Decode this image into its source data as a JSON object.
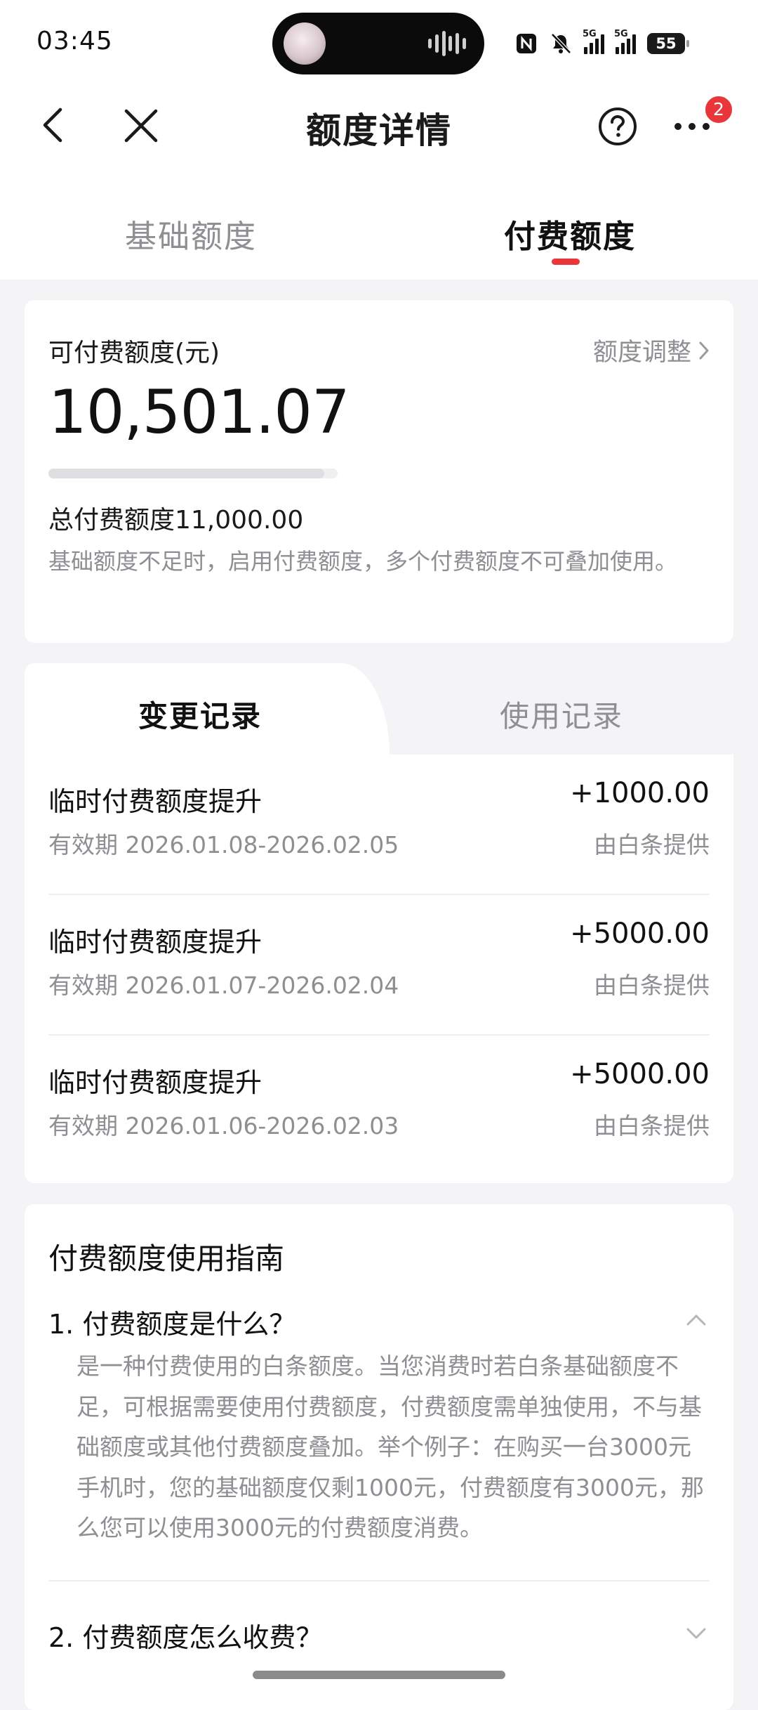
{
  "status": {
    "time": "03:45",
    "signal1_label": "5G",
    "signal2_label": "5G",
    "battery": "55"
  },
  "header": {
    "title": "额度详情",
    "badge_count": "2"
  },
  "tabs": {
    "basic": "基础额度",
    "paid": "付费额度"
  },
  "summary": {
    "available_label": "可付费额度(元)",
    "adjust_label": "额度调整",
    "available_amount": "10,501.07",
    "usage_fraction": 0.955,
    "total_label": "总付费额度11,000.00",
    "note": "基础额度不足时，启用付费额度，多个付费额度不可叠加使用。"
  },
  "records": {
    "tab_changes": "变更记录",
    "tab_usage": "使用记录",
    "items": [
      {
        "title": "临时付费额度提升",
        "period": "有效期 2026.01.08-2026.02.05",
        "amount": "+1000.00",
        "source": "由白条提供"
      },
      {
        "title": "临时付费额度提升",
        "period": "有效期 2026.01.07-2026.02.04",
        "amount": "+5000.00",
        "source": "由白条提供"
      },
      {
        "title": "临时付费额度提升",
        "period": "有效期 2026.01.06-2026.02.03",
        "amount": "+5000.00",
        "source": "由白条提供"
      }
    ]
  },
  "guide": {
    "title": "付费额度使用指南",
    "q1": "1. 付费额度是什么？",
    "a1": "是一种付费使用的白条额度。当您消费时若白条基础额度不足，可根据需要使用付费额度，付费额度需单独使用，不与基础额度或其他付费额度叠加。举个例子：在购买一台3000元手机时，您的基础额度仅剩1000元，付费额度有3000元，那么您可以使用3000元的付费额度消费。",
    "q2": "2. 付费额度怎么收费？"
  },
  "icons": {
    "back": "back-icon",
    "close": "close-icon",
    "help": "help-icon",
    "more": "more-icon",
    "chevron_up": "chevron-up-icon",
    "chevron_down": "chevron-down-icon"
  },
  "colors": {
    "accent": "#e8363b",
    "muted_text": "#8e8e93",
    "background": "#f4f4f6"
  }
}
